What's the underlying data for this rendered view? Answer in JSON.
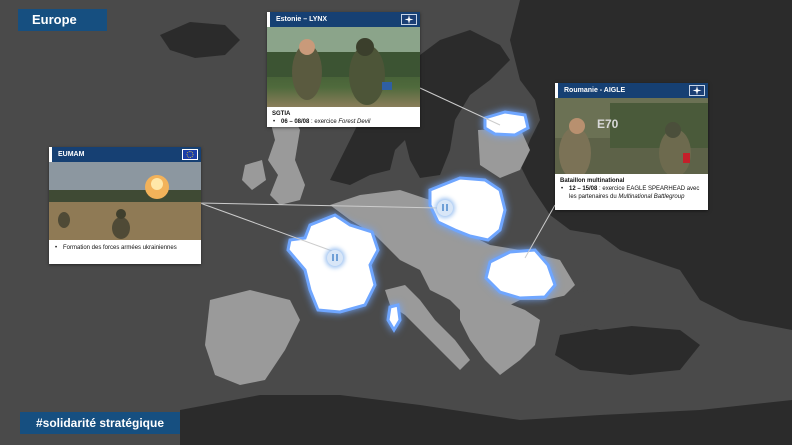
{
  "header": {
    "title": "Europe"
  },
  "footer": {
    "hashtag": "#solidarité stratégique"
  },
  "colors": {
    "sea": "#4a4a4a",
    "land": "#2b2b2b",
    "neighbor": "#9a9a9a",
    "highlight": "#ffffff",
    "glow": "#6fa6ff",
    "accent": "#164f80"
  },
  "cards": {
    "estonie": {
      "title": "Estonie – LYNX",
      "flag": "nato-star-icon",
      "unit": "SGTIA",
      "items": [
        {
          "date": "06 – 08/08",
          "text": " : exercice ",
          "italic": "Forest Devil"
        }
      ]
    },
    "roumanie": {
      "title": "Roumanie - AIGLE",
      "flag": "nato-star-icon",
      "unit": "Bataillon multinational",
      "items": [
        {
          "date": "12 – 15/08",
          "text": " : exercice EAGLE SPEARHEAD avec les partenaires du ",
          "italic": "Multinational Battlegroup"
        }
      ]
    },
    "eumam": {
      "title": "EUMAM",
      "flag": "eu-flag-icon",
      "items": [
        {
          "text": "Formation des forces armées ukrainiennes"
        }
      ]
    }
  },
  "highlighted_countries": [
    "France",
    "Pologne",
    "Roumanie",
    "Estonie",
    "Corse"
  ]
}
